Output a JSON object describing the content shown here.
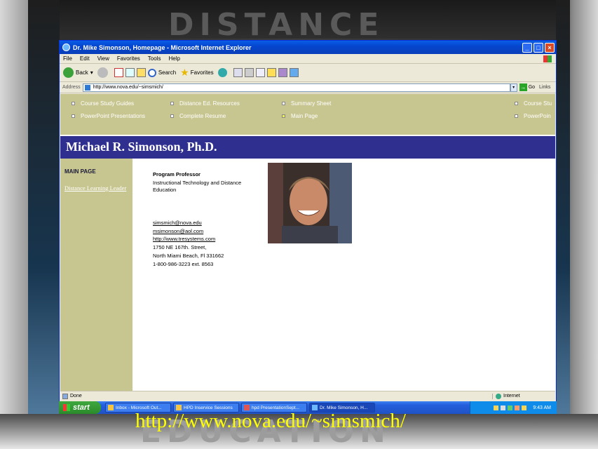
{
  "slide": {
    "decor_top": "DISTANCE",
    "decor_bottom": "EDUCATION",
    "caption": "http://www.nova.edu/~simsmich/"
  },
  "window": {
    "title": "Dr. Mike Simonson, Homepage - Microsoft Internet Explorer",
    "min": "_",
    "max": "□",
    "close": "×"
  },
  "menu": [
    "File",
    "Edit",
    "View",
    "Favorites",
    "Tools",
    "Help"
  ],
  "toolbar": {
    "back": "Back",
    "search": "Search",
    "favorites": "Favorites"
  },
  "address": {
    "label": "Address",
    "url": "http://www.nova.edu/~simsmich/",
    "go": "Go",
    "links": "Links"
  },
  "nav": {
    "row1": [
      "Course Study Guides",
      "Distance Ed. Resources",
      "Summary Sheet",
      "Course Stu"
    ],
    "row2": [
      "PowerPoint Presentations",
      "Complete Resume",
      "Main Page",
      "PowerPoin"
    ]
  },
  "page": {
    "banner": "Michael R. Simonson, Ph.D.",
    "sidebar_header": "MAIN PAGE",
    "sidebar_link": "Distance Learning Leader",
    "role": "Program Professor",
    "dept": "Instructional Technology and Distance Education",
    "email1": "simsmich@nova.edu",
    "email2": "msimonson@aol.com",
    "website": "http://www.tresystems.com",
    "street": "1750 NE 167th. Street,",
    "city": "North Miami Beach, Fl 331662",
    "phone": "1-800-986-3223 ext. 8563"
  },
  "status": {
    "text": "Done",
    "zone": "Internet"
  },
  "taskbar": {
    "start": "start",
    "tasks": [
      "Inbox - Microsoft Out...",
      "HPD Inservice Sessions",
      "hpd PresentationSept...",
      "Dr. Mike Simonson, H..."
    ],
    "clock": "9:43 AM"
  }
}
